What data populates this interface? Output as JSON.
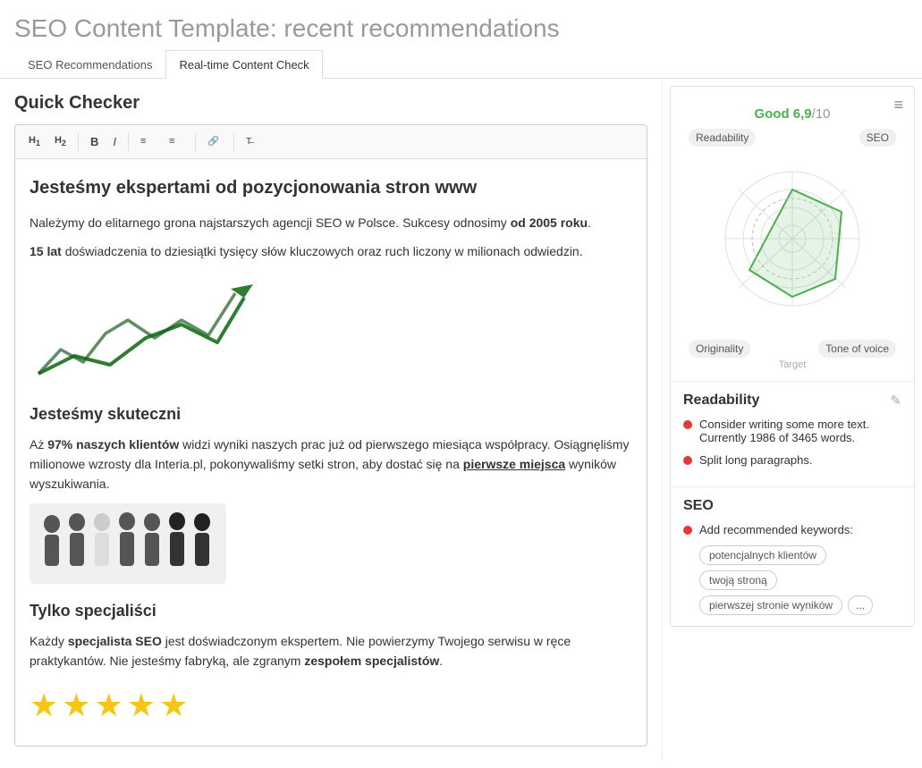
{
  "header": {
    "title_static": "SEO Content Template:",
    "title_dynamic": " recent recommendations"
  },
  "tabs": [
    {
      "id": "seo-recommendations",
      "label": "SEO Recommendations",
      "active": false
    },
    {
      "id": "realtime-content-check",
      "label": "Real-time Content Check",
      "active": true
    }
  ],
  "quick_checker": {
    "title": "Quick Checker"
  },
  "toolbar": {
    "buttons": [
      "H1",
      "H2",
      "B",
      "I",
      "OL",
      "UL",
      "Link",
      "Clear"
    ]
  },
  "editor": {
    "heading": "Jesteśmy ekspertami od pozycjonowania stron www",
    "paragraph1": "Należymy do elitarnego grona najstarszych agencji SEO w Polsce. Sukcesy odnosimy od 2005 roku.",
    "paragraph2": "15 lat doświadczenia to dziesiątki tysięcy słów kluczowych oraz ruch liczony w milionach odwiedzin.",
    "heading2": "Jesteśmy skuteczni",
    "paragraph3_pre": "Aż 97% naszych klientów widzi wyniki naszych prac już od pierwszego miesiąca współpracy. Osiągnęliśmy milionowe wzrosty dla Interia.pl, pokonywaliśmy setki stron, aby dostać się na",
    "paragraph3_link": "pierwsze miejsca",
    "paragraph3_post": " wyników wyszukiwania.",
    "heading3": "Tylko specjaliści",
    "paragraph4_pre": "Każdy",
    "paragraph4_bold1": "specjalista SEO",
    "paragraph4_mid": " jest doświadczonym ekspertem. Nie powierzymy Twojego serwisu w ręce praktykantów. Nie jesteśmy fabryką, ale zgranym",
    "paragraph4_bold2": "zespołem specjalistów",
    "paragraph4_post": "."
  },
  "score_panel": {
    "menu_icon": "≡",
    "score_label": "Good",
    "score_value": "6,9",
    "score_denom": "/10",
    "labels": {
      "readability": "Readability",
      "seo": "SEO",
      "originality": "Originality",
      "tone_of_voice": "Tone of voice",
      "target": "Target"
    }
  },
  "readability_section": {
    "title": "Readability",
    "edit_icon": "✎",
    "recommendations": [
      {
        "text": "Consider writing some more text. Currently 1986 of 3465 words."
      },
      {
        "text": "Split long paragraphs."
      }
    ]
  },
  "seo_section": {
    "title": "SEO",
    "add_keywords_label": "Add recommended keywords:",
    "keywords": [
      "potencjalnych klientów",
      "twoją stroną",
      "pierwszej stronie wyników"
    ],
    "more_label": "..."
  }
}
